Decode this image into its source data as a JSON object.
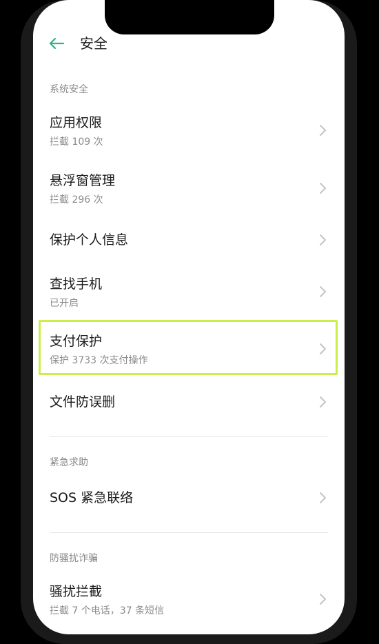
{
  "header": {
    "title": "安全",
    "back_icon": "back-arrow-icon",
    "accent_color": "#2fb380"
  },
  "sections": [
    {
      "label": "系统安全",
      "items": [
        {
          "label": "应用权限",
          "sub": "拦截 109 次"
        },
        {
          "label": "悬浮窗管理",
          "sub": "拦截 296 次"
        },
        {
          "label": "保护个人信息",
          "sub": ""
        },
        {
          "label": "查找手机",
          "sub": "已开启"
        },
        {
          "label": "支付保护",
          "sub": "保护 3733 次支付操作",
          "highlighted": true
        },
        {
          "label": "文件防误删",
          "sub": ""
        }
      ]
    },
    {
      "label": "紧急求助",
      "items": [
        {
          "label": "SOS 紧急联络",
          "sub": ""
        }
      ]
    },
    {
      "label": "防骚扰诈骗",
      "items": [
        {
          "label": "骚扰拦截",
          "sub": "拦截 7 个电话，37 条短信"
        }
      ]
    }
  ],
  "chevron_icon": "chevron-right-icon",
  "highlight_color": "#c8ef4a"
}
